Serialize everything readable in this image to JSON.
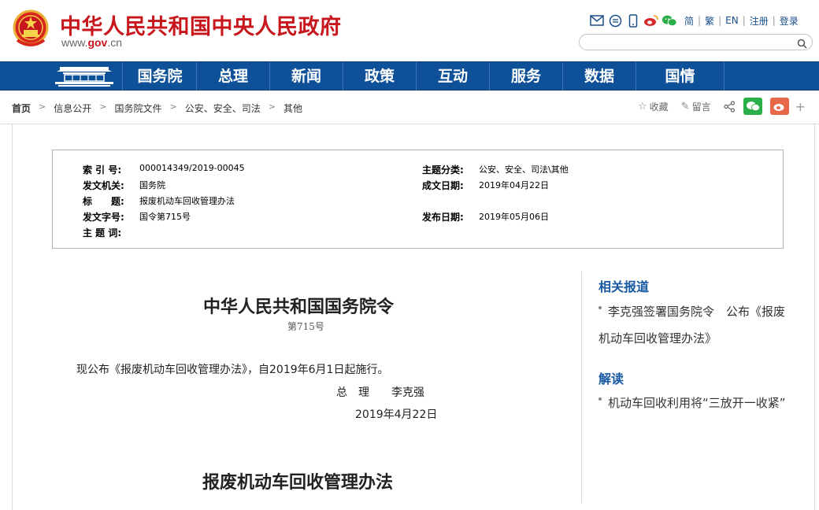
{
  "header": {
    "site_title": "中华人民共和国中央人民政府",
    "url_prefix": "www.",
    "url_domain": "gov",
    "url_suffix": ".cn",
    "links": [
      "简",
      "繁",
      "EN",
      "注册",
      "登录"
    ],
    "search_placeholder": ""
  },
  "nav": {
    "items": [
      "国务院",
      "总理",
      "新闻",
      "政策",
      "互动",
      "服务",
      "数据",
      "国情"
    ]
  },
  "breadcrumb": {
    "items": [
      "首页",
      "信息公开",
      "国务院文件",
      "公安、安全、司法",
      "其他"
    ],
    "separator": ">"
  },
  "actions": {
    "favorite": "收藏",
    "comment": "留言"
  },
  "meta": {
    "index_label": "索 引 号:",
    "index_value": "000014349/2019-00045",
    "issuer_label": "发文机关:",
    "issuer_value": "国务院",
    "title_label": "标　　题:",
    "title_value": "报废机动车回收管理办法",
    "docno_label": "发文字号:",
    "docno_value": "国令第715号",
    "keywords_label": "主 题 词:",
    "category_label": "主题分类:",
    "category_value": "公安、安全、司法\\其他",
    "created_label": "成文日期:",
    "created_value": "2019年04月22日",
    "published_label": "发布日期:",
    "published_value": "2019年05月06日"
  },
  "article": {
    "heading": "中华人民共和国国务院令",
    "number": "第715号",
    "paragraph": "现公布《报废机动车回收管理办法》，自2019年6月1日起施行。",
    "signature": "总　理　　李克强",
    "date": "2019年4月22日",
    "subheading": "报废机动车回收管理办法"
  },
  "sidebar": {
    "related_title": "相关报道",
    "related_items": [
      "李克强签署国务院令　公布《报废机动车回收管理办法》"
    ],
    "interpret_title": "解读",
    "interpret_items": [
      "机动车回收利用将“三放开一收紧”"
    ]
  },
  "colors": {
    "brand_red": "#c8161d",
    "nav_blue": "#0f5198",
    "link_blue": "#1a5aa3"
  }
}
